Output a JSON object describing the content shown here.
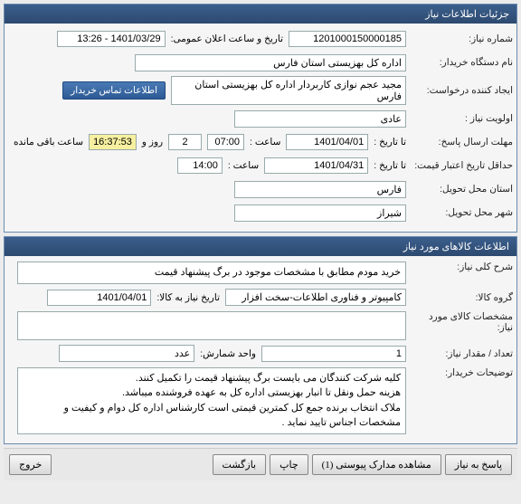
{
  "panel1": {
    "title": "جزئیات اطلاعات نیاز",
    "rows": {
      "need_no_label": "شماره نیاز:",
      "need_no": "1201000150000185",
      "announce_label": "تاریخ و ساعت اعلان عمومی:",
      "announce_val": "1401/03/29 - 13:26",
      "buyer_label": "نام دستگاه خریدار:",
      "buyer_val": "اداره کل بهزیستی استان فارس",
      "creator_label": "ایجاد کننده درخواست:",
      "creator_val": "مجید عجم نوازی کاربردار اداره کل بهزیستی استان فارس",
      "contact_btn": "اطلاعات تماس خریدار",
      "priority_label": "اولویت نیاز :",
      "priority_val": "عادی",
      "deadline_label": "مهلت ارسال پاسخ:",
      "deadline_to_label": "تا تاریخ :",
      "deadline_date": "1401/04/01",
      "time_label": "ساعت :",
      "deadline_time": "07:00",
      "days_count": "2",
      "days_and": "روز و",
      "remaining_time": "16:37:53",
      "remaining_label": "ساعت باقی مانده",
      "validity_label": "حداقل تاریخ اعتبار قیمت:",
      "validity_to_label": "تا تاریخ :",
      "validity_date": "1401/04/31",
      "validity_time": "14:00",
      "province_label": "استان محل تحویل:",
      "province_val": "فارس",
      "city_label": "شهر محل تحویل:",
      "city_val": "شیراز"
    }
  },
  "panel2": {
    "title": "اطلاعات کالاهای مورد نیاز",
    "rows": {
      "desc_label": "شرح کلی نیاز:",
      "desc_val": "خرید مودم مطابق با مشخصات موجود در برگ پیشنهاد قیمت",
      "group_label": "گروه کالا:",
      "group_val": "کامپیوتر و فناوری اطلاعات-سخت افزار",
      "need_date_label": "تاریخ نیاز به کالا:",
      "need_date_val": "1401/04/01",
      "spec_label": "مشخصات کالای مورد نیاز:",
      "spec_val": "",
      "qty_label": "تعداد / مقدار نیاز:",
      "qty_val": "1",
      "unit_label": "واحد شمارش:",
      "unit_val": "عدد",
      "notes_label": "توضیحات خریدار:",
      "notes_val": "کلیه شرکت کنندگان می بایست برگ پیشنهاد قیمت را تکمیل کنند.\nهزینه حمل ونقل تا انبار بهزیستی اداره کل به عهده فروشنده میباشد.\nملاک انتخاب برنده جمع کل کمترین قیمتی است کارشناس اداره کل دوام و کیفیت و مشخصات اجناس تایید نماید ."
    }
  },
  "footer": {
    "reply": "پاسخ به نیاز",
    "attach": "مشاهده مدارک پیوستی (1)",
    "print": "چاپ",
    "back": "بازگشت",
    "exit": "خروج"
  }
}
